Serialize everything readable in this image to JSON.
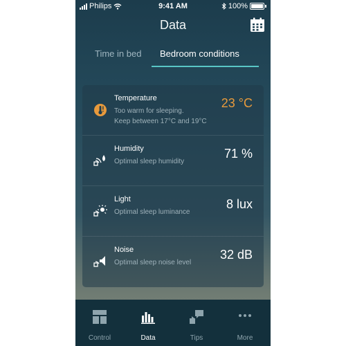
{
  "status_bar": {
    "carrier": "Philips",
    "time": "9:41 AM",
    "battery": "100%"
  },
  "header": {
    "title": "Data",
    "calendar_icon": "calendar-icon"
  },
  "tabs": [
    {
      "label": "Time in bed",
      "active": false
    },
    {
      "label": "Bedroom conditions",
      "active": true
    }
  ],
  "accent_colors": {
    "tab_underline": "#59c6c6",
    "warning": "#e89a3c"
  },
  "conditions": [
    {
      "icon": "thermometer-warning-icon",
      "title": "Temperature",
      "subtitle_line1": "Too warm for sleeping.",
      "subtitle_line2": "Keep between 17°C and 19°C",
      "value": "23 °C",
      "status": "warning"
    },
    {
      "icon": "humidity-icon",
      "title": "Humidity",
      "subtitle_line1": "Optimal sleep humidity",
      "subtitle_line2": "",
      "value": "71 %",
      "status": "ok"
    },
    {
      "icon": "light-icon",
      "title": "Light",
      "subtitle_line1": "Optimal sleep luminance",
      "subtitle_line2": "",
      "value": "8 lux",
      "status": "ok"
    },
    {
      "icon": "noise-icon",
      "title": "Noise",
      "subtitle_line1": "Optimal sleep noise level",
      "subtitle_line2": "",
      "value": "32 dB",
      "status": "ok"
    }
  ],
  "bottom_nav": [
    {
      "label": "Control",
      "icon": "control-grid-icon",
      "active": false
    },
    {
      "label": "Data",
      "icon": "bar-chart-icon",
      "active": true
    },
    {
      "label": "Tips",
      "icon": "tips-icon",
      "active": false
    },
    {
      "label": "More",
      "icon": "more-dots-icon",
      "active": false
    }
  ]
}
